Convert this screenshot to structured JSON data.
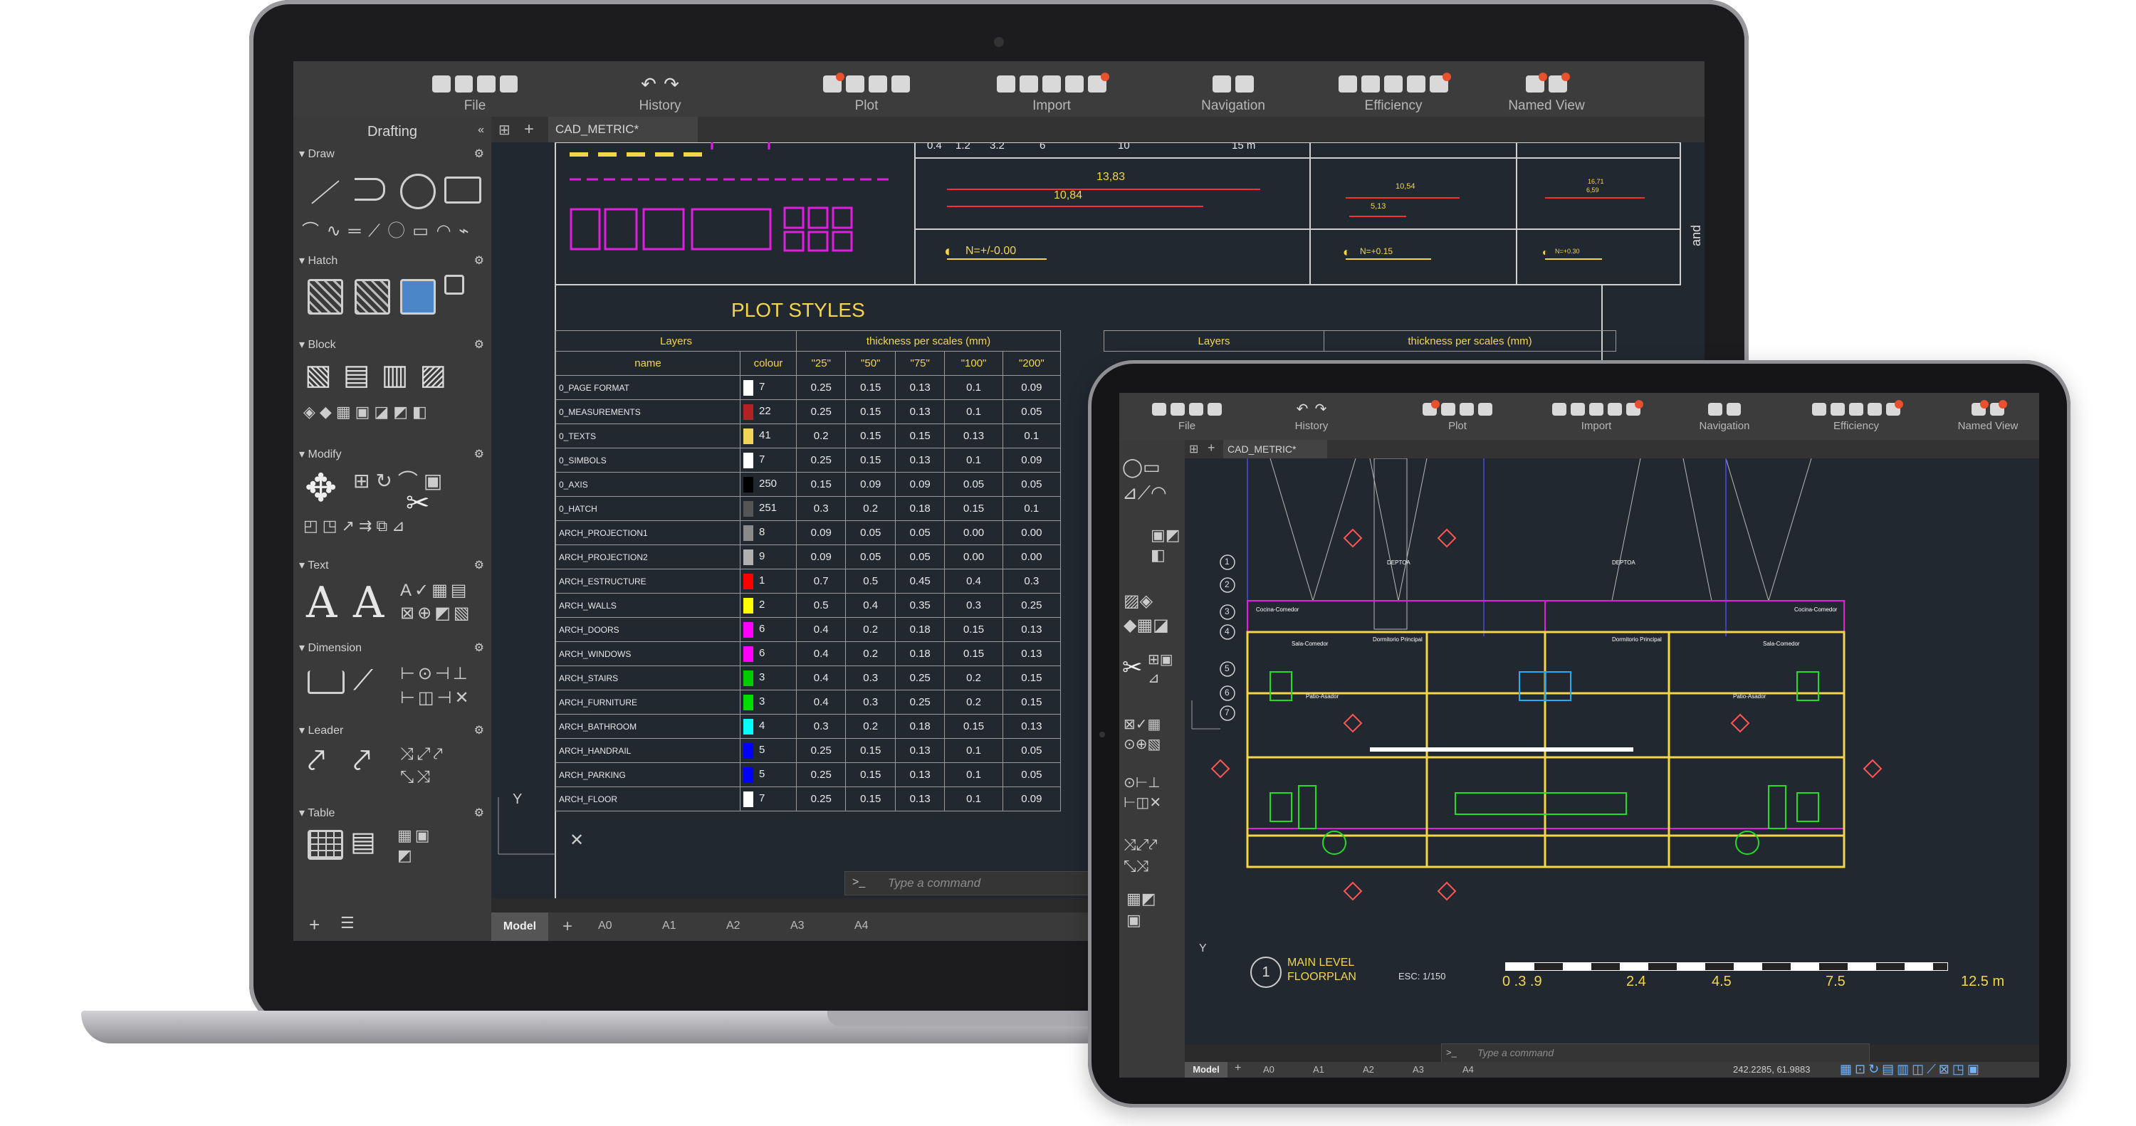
{
  "laptop": {
    "toolbar_groups": [
      "File",
      "History",
      "Plot",
      "Import",
      "Navigation",
      "Efficiency",
      "Named View"
    ],
    "panel_title": "Drafting",
    "panel_sections": [
      "Draw",
      "Hatch",
      "Block",
      "Modify",
      "Text",
      "Dimension",
      "Leader",
      "Table"
    ],
    "document_tab": "CAD_METRIC*",
    "right_panel_label": "and Properties",
    "top_scale_labels": [
      "0.4",
      "1.2",
      "3.2",
      "6",
      "10",
      "15 m"
    ],
    "top_dims": [
      "13,83",
      "10,84",
      "10,54",
      "5,13",
      "16,71",
      "6,59"
    ],
    "levels": [
      "N=+/-0.00",
      "N=+0.15",
      "N=+0.30"
    ],
    "plot_styles": {
      "title": "PLOT STYLES",
      "header_layers": "Layers",
      "header_thickness": "thickness per scales (mm)",
      "col_name": "name",
      "col_colour": "colour",
      "scales": [
        "\"25\"",
        "\"50\"",
        "\"75\"",
        "\"100\"",
        "\"200\""
      ],
      "rows": [
        {
          "name": "0_PAGE FORMAT",
          "color": "#ffffff",
          "num": "7",
          "v": [
            "0.25",
            "0.15",
            "0.13",
            "0.1",
            "0.09"
          ]
        },
        {
          "name": "0_MEASUREMENTS",
          "color": "#b22222",
          "num": "22",
          "v": [
            "0.25",
            "0.15",
            "0.13",
            "0.1",
            "0.05"
          ]
        },
        {
          "name": "0_TEXTS",
          "color": "#f2d45b",
          "num": "41",
          "v": [
            "0.2",
            "0.15",
            "0.15",
            "0.13",
            "0.1"
          ]
        },
        {
          "name": "0_SIMBOLS",
          "color": "#ffffff",
          "num": "7",
          "v": [
            "0.25",
            "0.15",
            "0.13",
            "0.1",
            "0.09"
          ]
        },
        {
          "name": "0_AXIS",
          "color": "#000000",
          "num": "250",
          "v": [
            "0.15",
            "0.09",
            "0.09",
            "0.05",
            "0.05"
          ]
        },
        {
          "name": "0_HATCH",
          "color": "#555555",
          "num": "251",
          "v": [
            "0.3",
            "0.2",
            "0.18",
            "0.15",
            "0.1"
          ]
        },
        {
          "name": "ARCH_PROJECTION1",
          "color": "#8a8a8a",
          "num": "8",
          "v": [
            "0.09",
            "0.05",
            "0.05",
            "0.00",
            "0.00"
          ]
        },
        {
          "name": "ARCH_PROJECTION2",
          "color": "#b0b0b0",
          "num": "9",
          "v": [
            "0.09",
            "0.05",
            "0.05",
            "0.00",
            "0.00"
          ]
        },
        {
          "name": "ARCH_ESTRUCTURE",
          "color": "#ff0000",
          "num": "1",
          "v": [
            "0.7",
            "0.5",
            "0.45",
            "0.4",
            "0.3"
          ]
        },
        {
          "name": "ARCH_WALLS",
          "color": "#ffff00",
          "num": "2",
          "v": [
            "0.5",
            "0.4",
            "0.35",
            "0.3",
            "0.25"
          ]
        },
        {
          "name": "ARCH_DOORS",
          "color": "#ff00ff",
          "num": "6",
          "v": [
            "0.4",
            "0.2",
            "0.18",
            "0.15",
            "0.13"
          ]
        },
        {
          "name": "ARCH_WINDOWS",
          "color": "#ff00ff",
          "num": "6",
          "v": [
            "0.4",
            "0.2",
            "0.18",
            "0.15",
            "0.13"
          ]
        },
        {
          "name": "ARCH_STAIRS",
          "color": "#00cc00",
          "num": "3",
          "v": [
            "0.4",
            "0.3",
            "0.25",
            "0.2",
            "0.15"
          ]
        },
        {
          "name": "ARCH_FURNITURE",
          "color": "#00dd00",
          "num": "3",
          "v": [
            "0.4",
            "0.3",
            "0.25",
            "0.2",
            "0.15"
          ]
        },
        {
          "name": "ARCH_BATHROOM",
          "color": "#00ffff",
          "num": "4",
          "v": [
            "0.3",
            "0.2",
            "0.18",
            "0.15",
            "0.13"
          ]
        },
        {
          "name": "ARCH_HANDRAIL",
          "color": "#0000ff",
          "num": "5",
          "v": [
            "0.25",
            "0.15",
            "0.13",
            "0.1",
            "0.05"
          ]
        },
        {
          "name": "ARCH_PARKING",
          "color": "#0000ff",
          "num": "5",
          "v": [
            "0.25",
            "0.15",
            "0.13",
            "0.1",
            "0.05"
          ]
        },
        {
          "name": "ARCH_FLOOR",
          "color": "#ffffff",
          "num": "7",
          "v": [
            "0.25",
            "0.15",
            "0.13",
            "0.1",
            "0.09"
          ]
        }
      ]
    },
    "second_table": {
      "header_layers": "Layers",
      "header_thickness": "thickness per scales (mm)"
    },
    "command_placeholder": "Type a command",
    "command_prompt": ">_",
    "layout_tabs": [
      "Model",
      "A0",
      "A1",
      "A2",
      "A3",
      "A4"
    ],
    "axis_y": "Y"
  },
  "tablet": {
    "toolbar_groups": [
      "File",
      "History",
      "Plot",
      "Import",
      "Navigation",
      "Efficiency",
      "Named View"
    ],
    "document_tab": "CAD_METRIC*",
    "rooms": [
      "DEPTOA",
      "DEPTOA",
      "Cocina-Comedor",
      "Cocina-Comedor",
      "Dormitorio Principal",
      "Dormitorio Principal",
      "Sala-Comedor",
      "Sala-Comedor",
      "Patio-Asador",
      "Patio-Asador"
    ],
    "axis_numbers": [
      "1",
      "2",
      "3",
      "4",
      "5",
      "6",
      "7"
    ],
    "title_line1": "MAIN LEVEL",
    "title_line2": "FLOORPLAN",
    "title_scale": "ESC: 1/150",
    "title_num": "1",
    "scale_labels": [
      "0 .3 .9",
      "2.4",
      "4.5",
      "7.5",
      "12.5 m"
    ],
    "command_placeholder": "Type a command",
    "command_prompt": ">_",
    "layout_tabs": [
      "Model",
      "A0",
      "A1",
      "A2",
      "A3",
      "A4"
    ],
    "coordinates": "242.2285, 61.9883",
    "axis_y": "Y"
  }
}
